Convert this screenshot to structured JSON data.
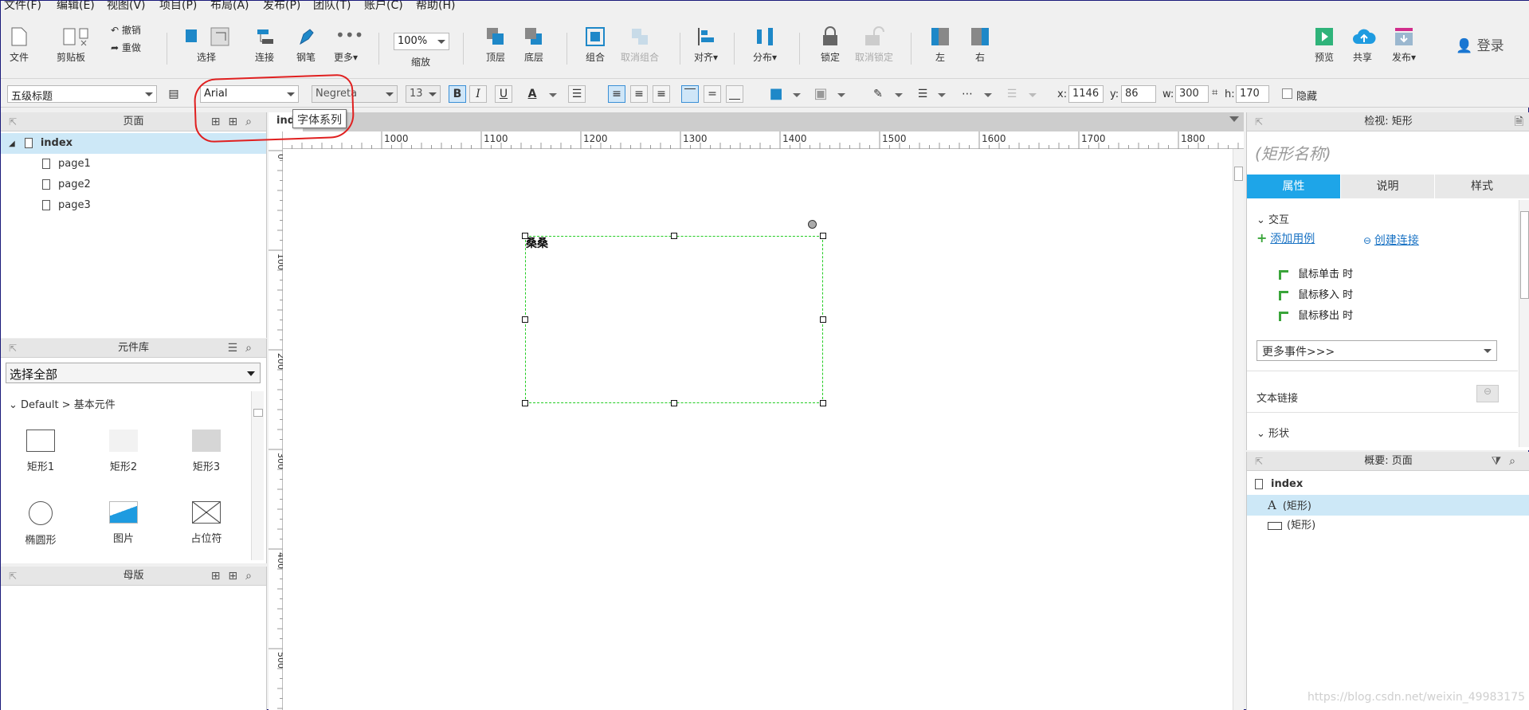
{
  "menubar": [
    "文件(F)",
    "编辑(E)",
    "视图(V)",
    "项目(P)",
    "布局(A)",
    "发布(P)",
    "团队(T)",
    "账户(C)",
    "帮助(H)"
  ],
  "toolbar": {
    "file": "文件",
    "clipboard": "剪贴板",
    "undo": "撤销",
    "redo": "重做",
    "select": "选择",
    "connect": "连接",
    "pen": "钢笔",
    "more": "更多▾",
    "zoom_value": "100%",
    "zoom": "缩放",
    "top_layer": "顶层",
    "bottom_layer": "底层",
    "group": "组合",
    "ungroup": "取消组合",
    "align": "对齐▾",
    "distribute": "分布▾",
    "lock": "锁定",
    "unlock": "取消锁定",
    "left": "左",
    "right": "右",
    "preview": "预览",
    "share": "共享",
    "publish": "发布▾",
    "login": "登录"
  },
  "format": {
    "style": "五级标题",
    "font_family": "Arial",
    "font_weight": "Negreta",
    "font_size": "13",
    "bold": "B",
    "italic": "I",
    "underline": "U",
    "x_label": "x:",
    "x": "1146",
    "y_label": "y:",
    "y": "86",
    "w_label": "w:",
    "w": "300",
    "h_label": "h:",
    "h": "170",
    "hidden": "隐藏"
  },
  "tooltip": "字体系列",
  "pages": {
    "title": "页面",
    "items": [
      "index",
      "page1",
      "page2",
      "page3"
    ]
  },
  "library": {
    "title": "元件库",
    "select": "选择全部",
    "group": "Default > 基本元件",
    "widgets": [
      "矩形1",
      "矩形2",
      "矩形3",
      "椭圆形",
      "图片",
      "占位符"
    ]
  },
  "masters": {
    "title": "母版"
  },
  "canvas": {
    "tab": "ind",
    "ruler_h": [
      "1000",
      "1100",
      "1200",
      "1300",
      "1400",
      "1500",
      "1600",
      "1700",
      "1800"
    ],
    "ruler_v": [
      "0",
      "100",
      "200",
      "300",
      "400",
      "500"
    ],
    "shape_text": "桑桑"
  },
  "inspector": {
    "title": "检视: 矩形",
    "name_placeholder": "(矩形名称)",
    "tabs": [
      "属性",
      "说明",
      "样式"
    ],
    "interaction": "交互",
    "add_case": "添加用例",
    "create_link": "创建连接",
    "events": [
      "鼠标单击 时",
      "鼠标移入 时",
      "鼠标移出 时"
    ],
    "more_events": "更多事件>>>",
    "text_link": "文本链接",
    "shape_section": "形状"
  },
  "outline": {
    "title": "概要: 页面",
    "root": "index",
    "items": [
      "(矩形)",
      "(矩形)"
    ]
  },
  "watermark": "https://blog.csdn.net/weixin_49983175",
  "colors": {
    "accent": "#1ea5e8",
    "selection": "#cde8f7",
    "annotation": "#e02020",
    "shape_border": "#22cc22"
  }
}
